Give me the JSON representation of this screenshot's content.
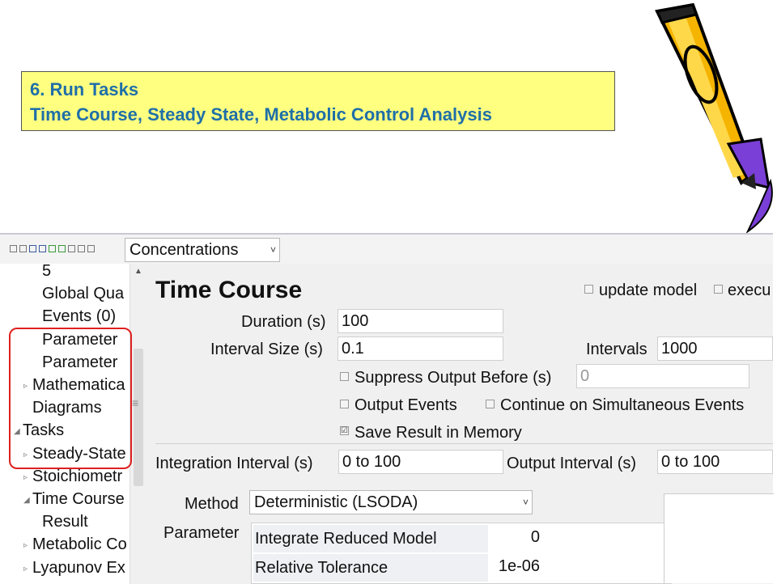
{
  "slide": {
    "heading": "6. Run Tasks",
    "subheading": "Time Course, Steady State, Metabolic Control Analysis"
  },
  "toolbar": {
    "view_select": "Concentrations"
  },
  "tree": {
    "items": [
      {
        "label": "5",
        "level": 2,
        "expander": "none"
      },
      {
        "label": "Global Qua",
        "level": 2,
        "expander": "none"
      },
      {
        "label": "Events (0)",
        "level": 2,
        "expander": "none"
      },
      {
        "label": "Parameter",
        "level": 2,
        "expander": "none"
      },
      {
        "label": "Parameter",
        "level": 2,
        "expander": "none"
      },
      {
        "label": "Mathematica",
        "level": 1,
        "expander": "collapsed"
      },
      {
        "label": "Diagrams",
        "level": 1,
        "expander": "none"
      },
      {
        "label": "Tasks",
        "level": 0,
        "expander": "expanded"
      },
      {
        "label": "Steady-State",
        "level": 1,
        "expander": "collapsed"
      },
      {
        "label": "Stoichiometr",
        "level": 1,
        "expander": "collapsed"
      },
      {
        "label": "Time Course",
        "level": 1,
        "expander": "expanded"
      },
      {
        "label": "Result",
        "level": 2,
        "expander": "none"
      },
      {
        "label": "Metabolic Co",
        "level": 1,
        "expander": "collapsed"
      },
      {
        "label": "Lyapunov Ex",
        "level": 1,
        "expander": "collapsed"
      }
    ]
  },
  "task": {
    "title": "Time Course",
    "update_model_label": "update model",
    "execute_label": "execu",
    "duration_label": "Duration (s)",
    "duration_value": "100",
    "interval_size_label": "Interval Size (s)",
    "interval_size_value": "0.1",
    "intervals_label": "Intervals",
    "intervals_value": "1000",
    "suppress_output_label": "Suppress Output Before (s)",
    "suppress_output_value": "0",
    "output_events_label": "Output Events",
    "continue_events_label": "Continue on Simultaneous Events",
    "save_result_label": "Save Result in Memory",
    "save_result_checked": "☑",
    "integration_interval_label": "Integration Interval (s)",
    "integration_interval_value": "0 to 100",
    "output_interval_label": "Output Interval (s)",
    "output_interval_value": "0 to 100",
    "method_label": "Method",
    "method_value": "Deterministic (LSODA)",
    "parameter_label": "Parameter",
    "parameters": [
      {
        "name": "Integrate Reduced Model",
        "value": "0"
      },
      {
        "name": "Relative Tolerance",
        "value": "1e-06"
      }
    ]
  },
  "colors": {
    "heading_text": "#1f6fa8",
    "heading_bg": "#ffff80",
    "highlight": "#e02020"
  }
}
